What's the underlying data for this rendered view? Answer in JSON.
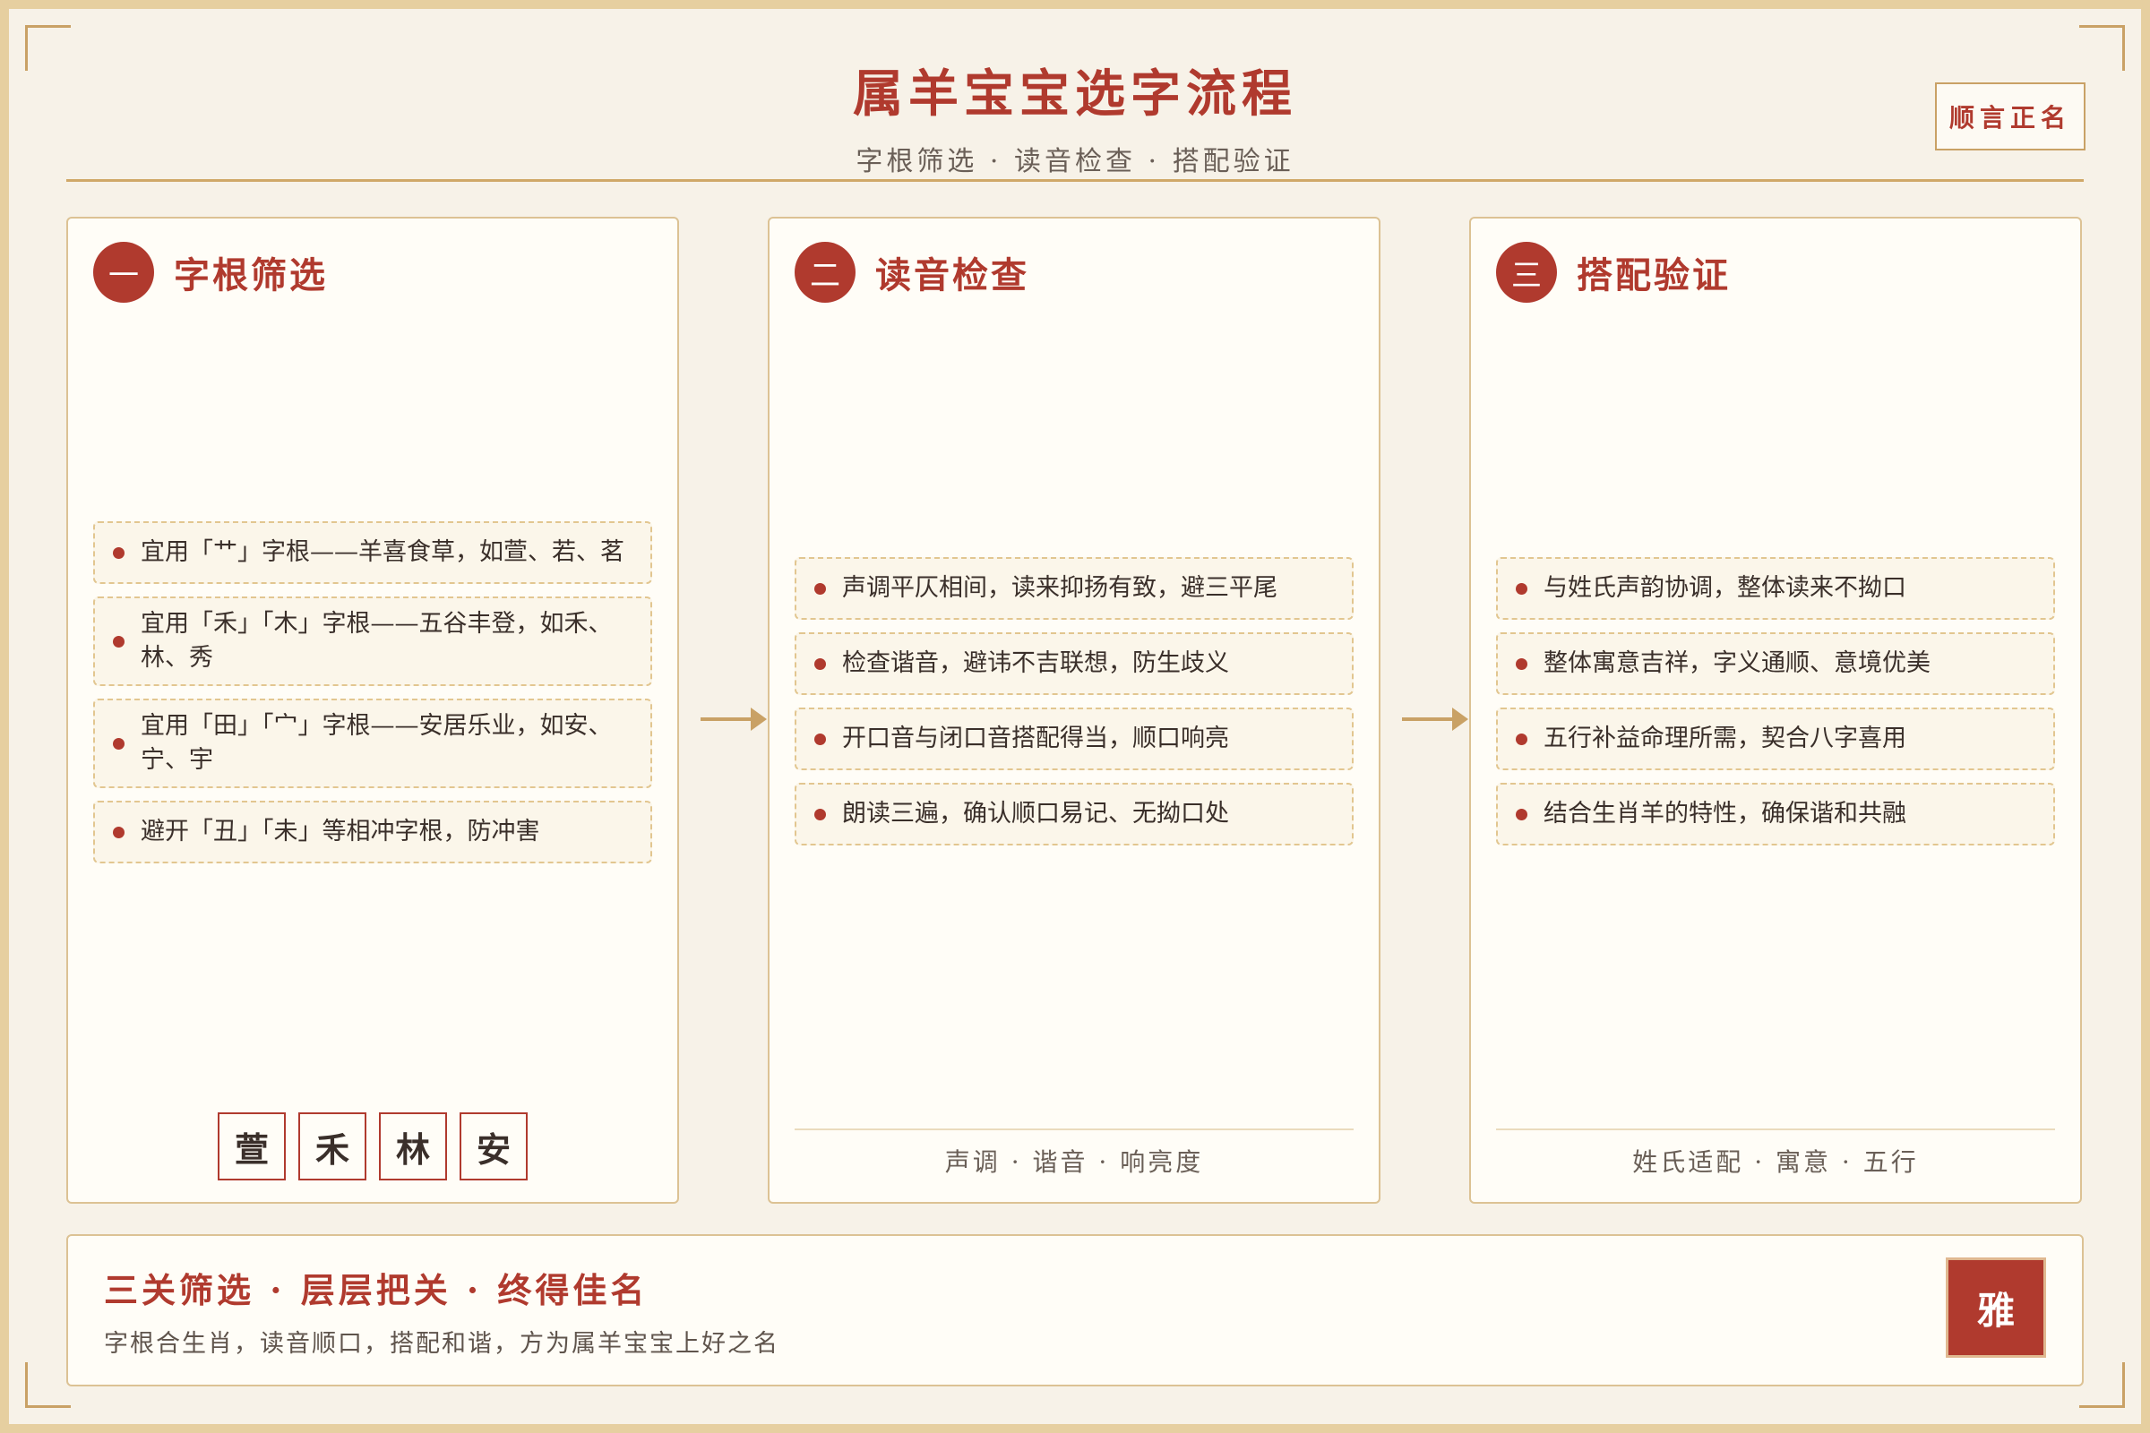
{
  "header": {
    "title": "属羊宝宝选字流程",
    "subtitle": "字根筛选 · 读音检查 · 搭配验证",
    "stamp": "顺言正名"
  },
  "steps": [
    {
      "number": "一",
      "title": "字根筛选",
      "items": [
        "宜用「艹」字根——羊喜食草，如萱、若、茗",
        "宜用「禾」「木」字根——五谷丰登，如禾、林、秀",
        "宜用「田」「宀」字根——安居乐业，如安、宁、宇",
        "避开「丑」「未」等相冲字根，防冲害"
      ],
      "chars": [
        "萱",
        "禾",
        "林",
        "安"
      ]
    },
    {
      "number": "二",
      "title": "读音检查",
      "items": [
        "声调平仄相间，读来抑扬有致，避三平尾",
        "检查谐音，避讳不吉联想，防生歧义",
        "开口音与闭口音搭配得当，顺口响亮",
        "朗读三遍，确认顺口易记、无拗口处"
      ],
      "footer": "声调 · 谐音 · 响亮度"
    },
    {
      "number": "三",
      "title": "搭配验证",
      "items": [
        "与姓氏声韵协调，整体读来不拗口",
        "整体寓意吉祥，字义通顺、意境优美",
        "五行补益命理所需，契合八字喜用",
        "结合生肖羊的特性，确保谐和共融"
      ],
      "footer": "姓氏适配 · 寓意 · 五行"
    }
  ],
  "banner": {
    "title": "三关筛选 · 层层把关 · 终得佳名",
    "subtitle": "字根合生肖，读音顺口，搭配和谐，方为属羊宝宝上好之名",
    "seal": "雅"
  },
  "colors": {
    "accent": "#b03a2e",
    "gold": "#c9a165",
    "background": "#f7f2e8"
  }
}
